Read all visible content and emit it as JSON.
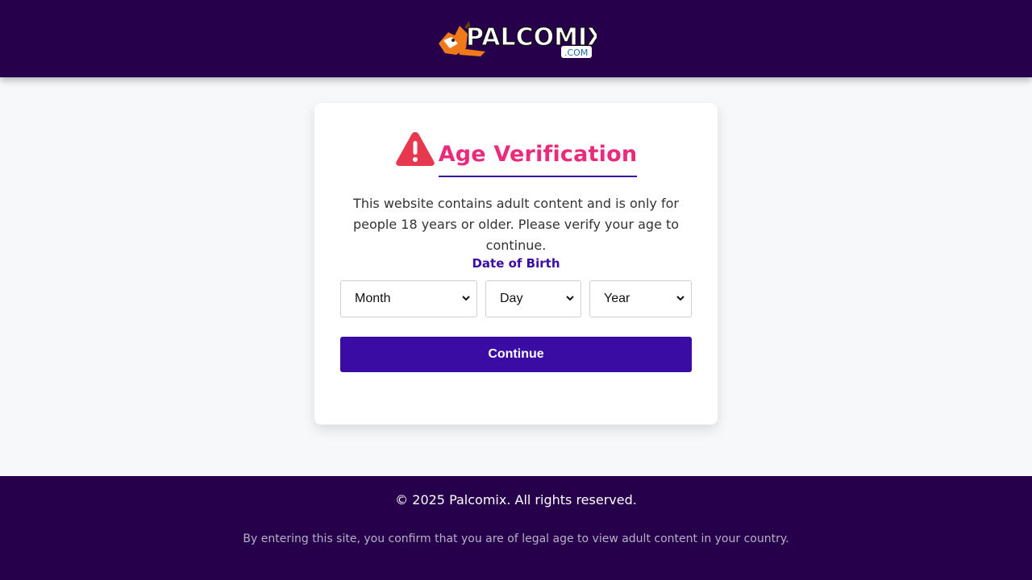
{
  "header": {
    "logo_text": "PALCOMIX",
    "logo_sub": ".COM"
  },
  "card": {
    "title": "Age Verification",
    "description": "This website contains adult content and is only for people 18 years or older. Please verify your age to continue.",
    "dob_label": "Date of Birth",
    "selects": {
      "month": "Month",
      "day": "Day",
      "year": "Year"
    },
    "continue_label": "Continue",
    "warning_icon": "warning-triangle-icon"
  },
  "footer": {
    "copyright": "© 2025 Palcomix. All rights reserved.",
    "disclaimer": "By entering this site, you confirm that you are of legal age to view adult content in your country."
  },
  "colors": {
    "header_bg": "#26004a",
    "accent": "#3a0ca3",
    "title": "#ea2b7b",
    "warning": "#e63950"
  }
}
